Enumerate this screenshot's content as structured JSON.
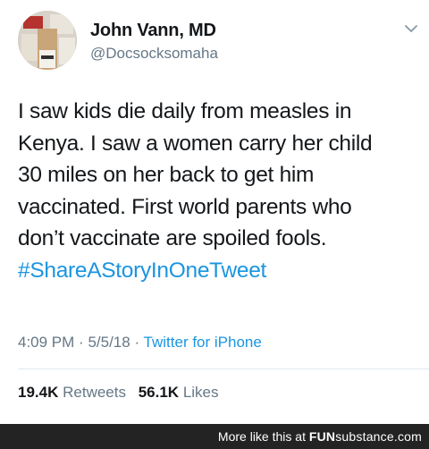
{
  "tweet": {
    "author": {
      "display_name": "John Vann, MD",
      "handle": "@Docsocksomaha"
    },
    "text_lines": [
      "I saw kids die daily from measles in",
      "Kenya. I saw a women carry her child",
      "30 miles on her back to get him",
      "vaccinated. First world parents who",
      "don’t vaccinate are spoiled fools."
    ],
    "hashtag": "#ShareAStoryInOneTweet",
    "time": "4:09 PM",
    "date": "5/5/18",
    "separator": "·",
    "source": "Twitter for iPhone",
    "retweets": {
      "count": "19.4K",
      "label": "Retweets"
    },
    "likes": {
      "count": "56.1K",
      "label": "Likes"
    }
  },
  "footer": {
    "text": "More like this at",
    "brand_bold": "FUN",
    "brand_light": "substance",
    "brand_suffix": ".com"
  },
  "icons": {
    "menu": "chevron-down-icon"
  },
  "colors": {
    "link": "#1b95e0",
    "secondary": "#657786",
    "text": "#14171a",
    "footer_bg": "#232323"
  }
}
